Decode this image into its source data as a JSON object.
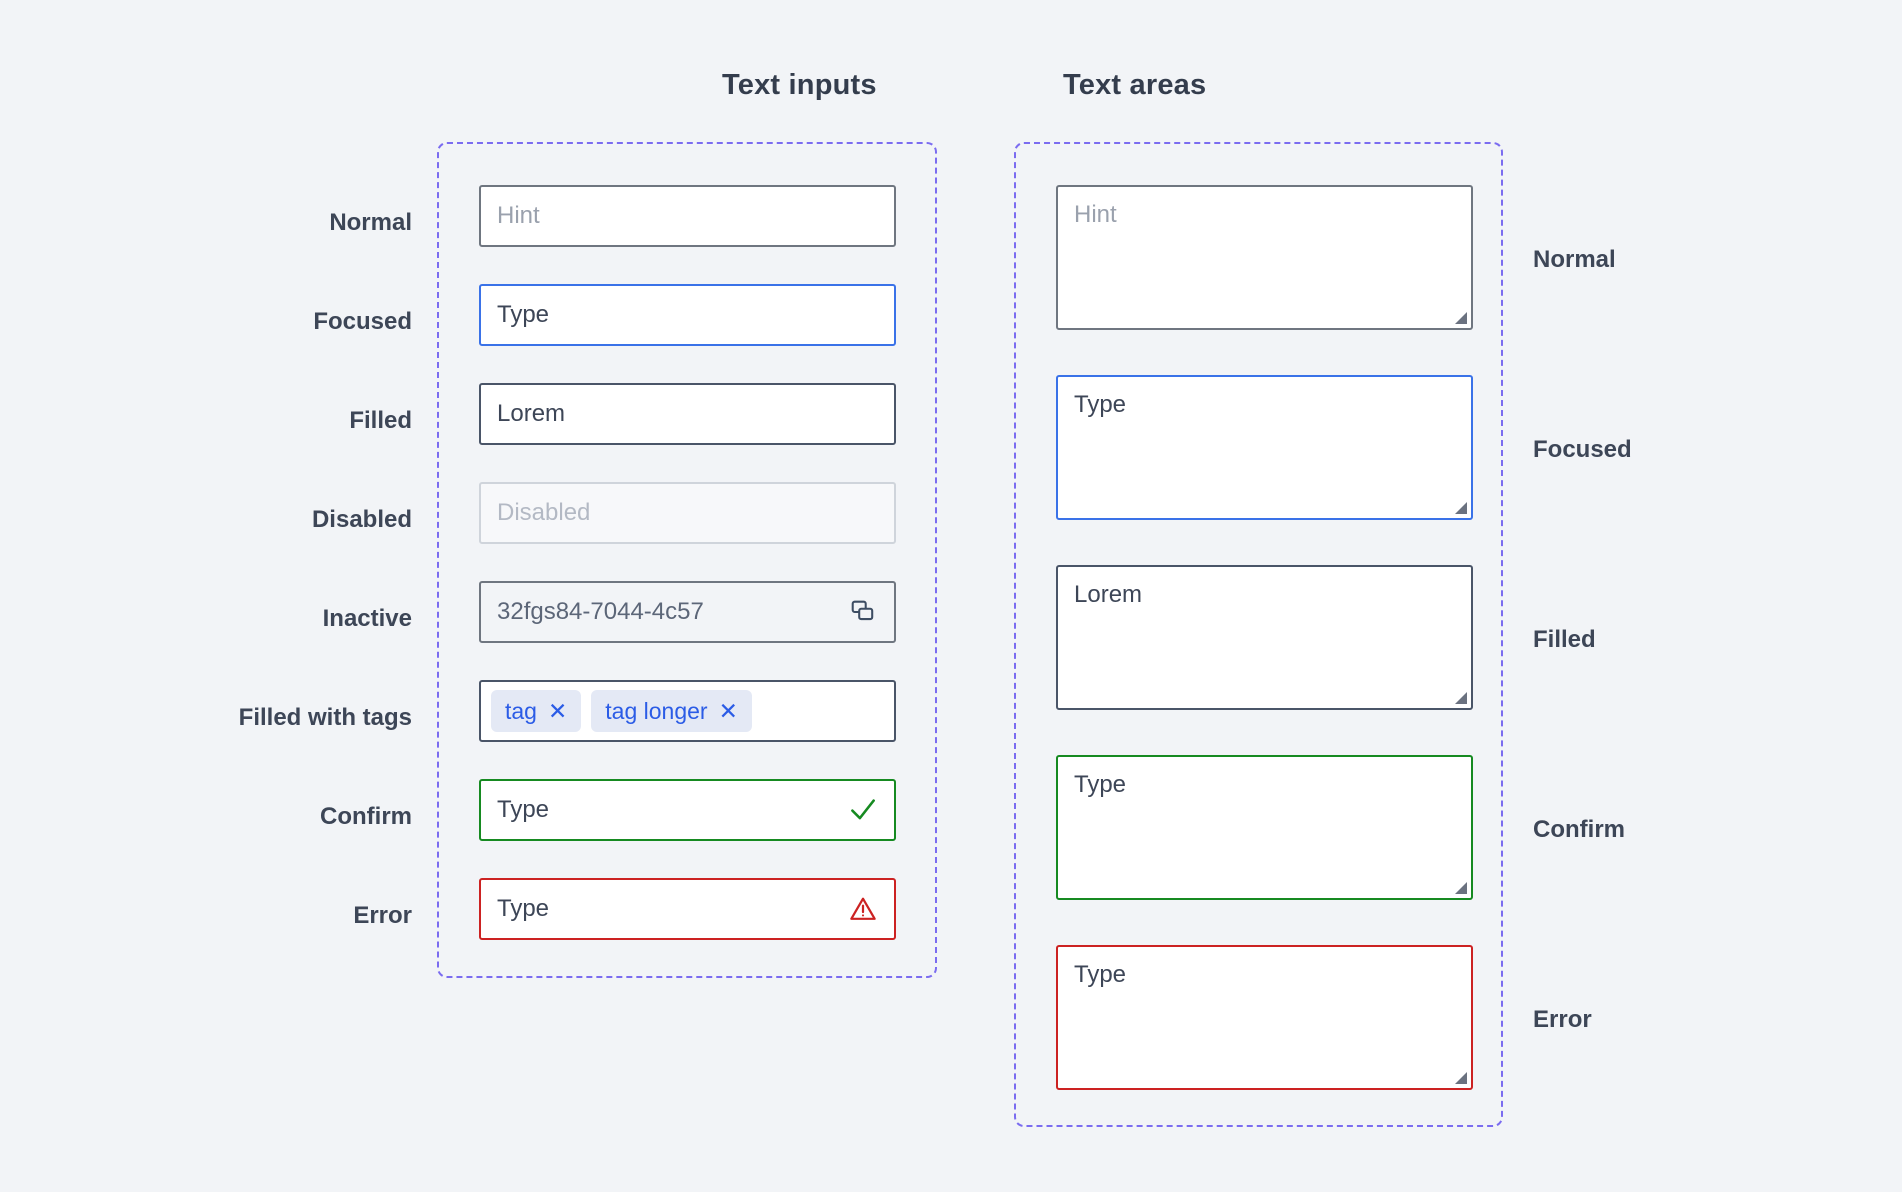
{
  "headings": {
    "text_inputs": "Text inputs",
    "text_areas": "Text areas"
  },
  "colors": {
    "page_background": "#f2f4f7",
    "dashed_guide": "#7b6cf0",
    "label_text": "#3d4657",
    "border_normal": "#6f7680",
    "border_focused": "#3a72e8",
    "border_filled": "#4a5568",
    "border_disabled": "#cfd4db",
    "border_confirm": "#168a21",
    "border_error": "#cc2222",
    "tag_background": "#e4e9f5",
    "tag_text": "#2b5ce6",
    "placeholder_text": "#9aa1ad"
  },
  "text_inputs": {
    "labels": [
      "Normal",
      "Focused",
      "Filled",
      "Disabled",
      "Inactive",
      "Filled with tags",
      "Confirm",
      "Error"
    ],
    "rows": [
      {
        "state": "normal",
        "value": "",
        "placeholder": "Hint",
        "icon": ""
      },
      {
        "state": "focused",
        "value": "Type",
        "placeholder": "",
        "icon": ""
      },
      {
        "state": "filled",
        "value": "Lorem",
        "placeholder": "",
        "icon": ""
      },
      {
        "state": "disabled",
        "value": "",
        "placeholder": "Disabled",
        "icon": ""
      },
      {
        "state": "inactive",
        "value": "32fgs84-7044-4c57",
        "placeholder": "",
        "icon": "copy-icon"
      },
      {
        "state": "tags",
        "value": "",
        "placeholder": "",
        "icon": ""
      },
      {
        "state": "confirm",
        "value": "Type",
        "placeholder": "",
        "icon": "check-icon"
      },
      {
        "state": "error",
        "value": "Type",
        "placeholder": "",
        "icon": "warning-icon"
      }
    ],
    "tags": [
      {
        "label": "tag",
        "remove": "✕"
      },
      {
        "label": "tag longer",
        "remove": "✕"
      }
    ]
  },
  "text_areas": {
    "labels": [
      "Normal",
      "Focused",
      "Filled",
      "Confirm",
      "Error"
    ],
    "rows": [
      {
        "state": "normal",
        "value": "",
        "placeholder": "Hint"
      },
      {
        "state": "focused",
        "value": "Type",
        "placeholder": ""
      },
      {
        "state": "filled",
        "value": "Lorem",
        "placeholder": ""
      },
      {
        "state": "confirm",
        "value": "Type",
        "placeholder": ""
      },
      {
        "state": "error",
        "value": "Type",
        "placeholder": ""
      }
    ]
  }
}
